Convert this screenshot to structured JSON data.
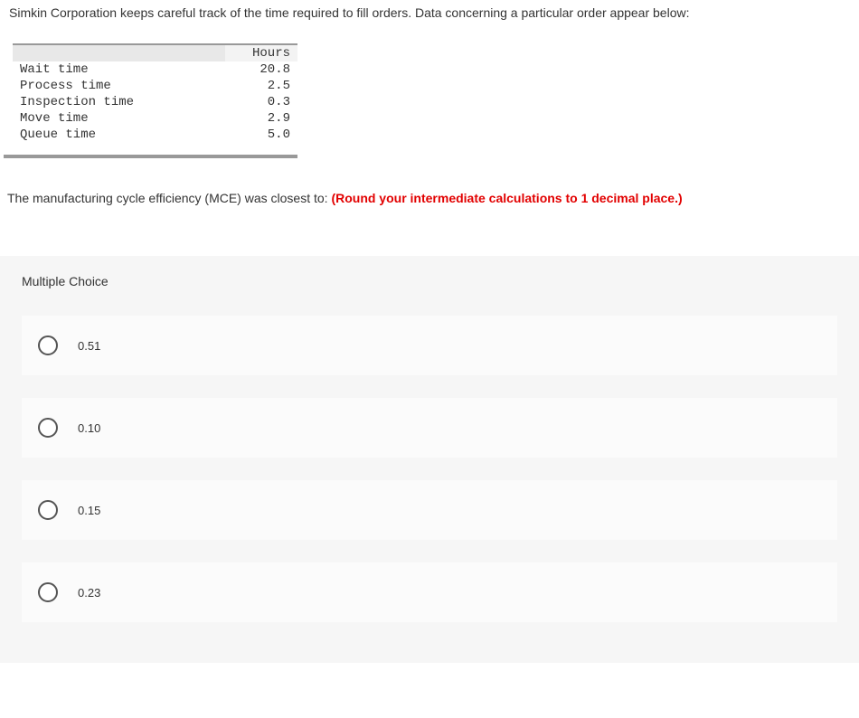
{
  "intro": "Simkin Corporation keeps careful track of the time required to fill orders. Data concerning a particular order appear below:",
  "table": {
    "header_col2": "Hours",
    "rows": [
      {
        "label": "Wait time",
        "value": "20.8"
      },
      {
        "label": "Process time",
        "value": "2.5"
      },
      {
        "label": "Inspection time",
        "value": "0.3"
      },
      {
        "label": "Move time",
        "value": "2.9"
      },
      {
        "label": "Queue time",
        "value": "5.0"
      }
    ]
  },
  "question": {
    "prefix": "The manufacturing cycle efficiency (MCE) was closest to: ",
    "emphasis": "(Round your intermediate calculations to 1 decimal place.)"
  },
  "mc": {
    "title": "Multiple Choice",
    "options": [
      {
        "label": "0.51"
      },
      {
        "label": "0.10"
      },
      {
        "label": "0.15"
      },
      {
        "label": "0.23"
      }
    ]
  }
}
